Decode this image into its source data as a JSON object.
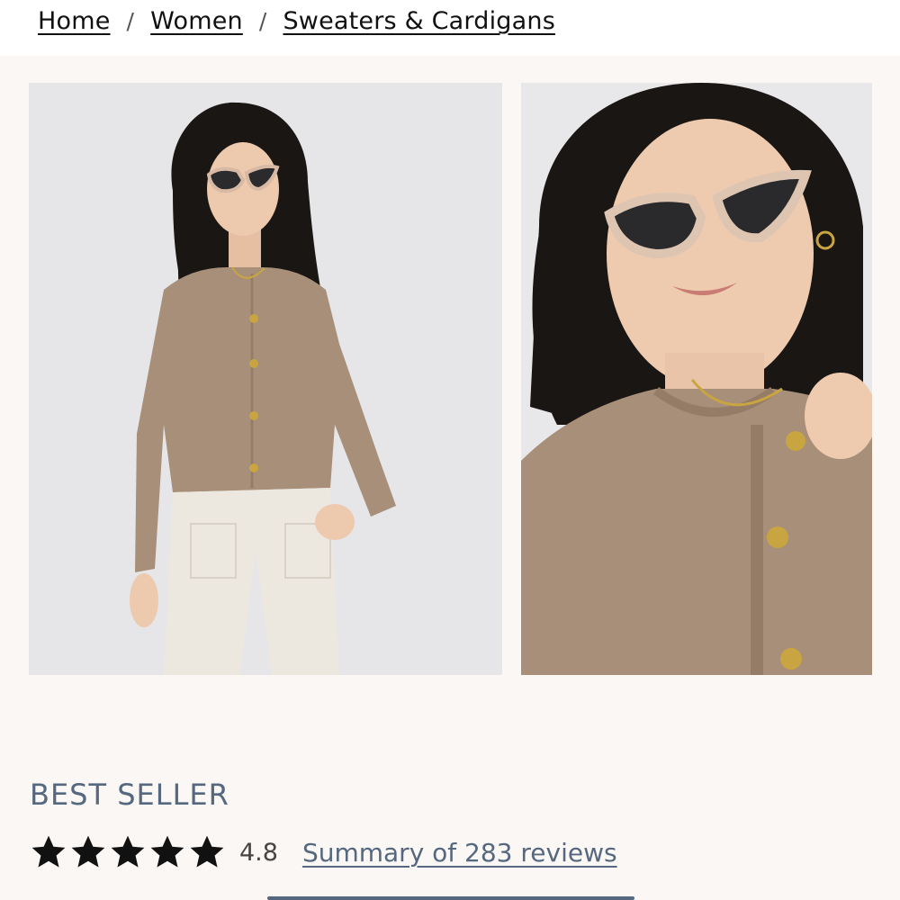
{
  "breadcrumb": {
    "items": [
      "Home",
      "Women",
      "Sweaters & Cardigans"
    ],
    "separator": "/"
  },
  "gallery": {
    "images": [
      {
        "alt": "",
        "icon": "product-photo-full-body"
      },
      {
        "alt": "",
        "icon": "product-photo-closeup"
      }
    ]
  },
  "product": {
    "badge": "BEST SELLER",
    "rating": "4.8",
    "stars": 4.8,
    "reviews_link": "Summary of 283 reviews"
  },
  "colors": {
    "accent": "#55687f",
    "sweater": "#a88f79",
    "background": "#faf7f4"
  }
}
